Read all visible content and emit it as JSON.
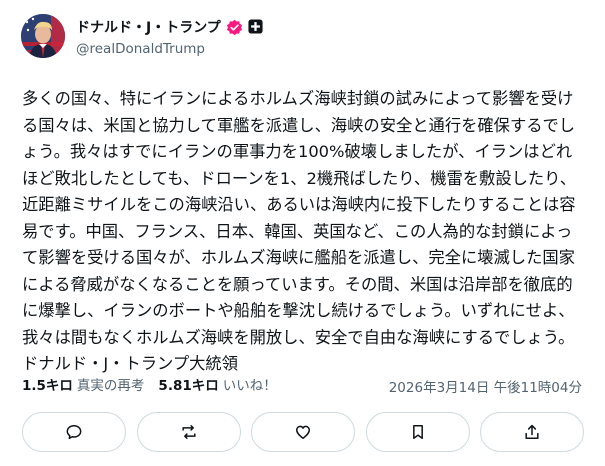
{
  "post": {
    "author": {
      "display_name": "ドナルド・J・トランプ",
      "handle": "@realDonaldTrump",
      "verified_color": "#f91880"
    },
    "text": "多くの国々、特にイランによるホルムズ海峡封鎖の試みによって影響を受ける国々は、米国と協力して軍艦を派遣し、海峡の安全と通行を確保するでしょう。我々はすでにイランの軍事力を100%破壊しましたが、イランはどれほど敗北したとしても、ドローンを1、2機飛ばしたり、機雷を敷設したり、近距離ミサイルをこの海峡沿い、あるいは海峡内に投下したりすることは容易です。中国、フランス、日本、韓国、英国など、この人為的な封鎖によって影響を受ける国々が、ホルムズ海峡に艦船を派遣し、完全に壊滅した国家による脅威がなくなることを願っています。その間、米国は沿岸部を徹底的に爆撃し、イランのボートや船舶を撃沈し続けるでしょう。いずれにせよ、我々は間もなくホルムズ海峡を開放し、安全で自由な海峡にするでしょう。ドナルド・J・トランプ大統領",
    "stats": {
      "reposts_count": "1.5キロ",
      "reposts_label": "真実の再考",
      "likes_count": "5.81キロ",
      "likes_label": "いいね！"
    },
    "timestamp": "2026年3月14日 午後11時04分"
  },
  "actions": [
    {
      "name": "reply",
      "icon": "speech-bubble-icon"
    },
    {
      "name": "repost",
      "icon": "repost-arrows-icon"
    },
    {
      "name": "like",
      "icon": "heart-icon"
    },
    {
      "name": "bookmark",
      "icon": "bookmark-icon"
    },
    {
      "name": "share",
      "icon": "share-upload-icon"
    }
  ],
  "colors": {
    "text_primary": "#0f1419",
    "text_secondary": "#536471",
    "button_border": "#cfd9de"
  }
}
